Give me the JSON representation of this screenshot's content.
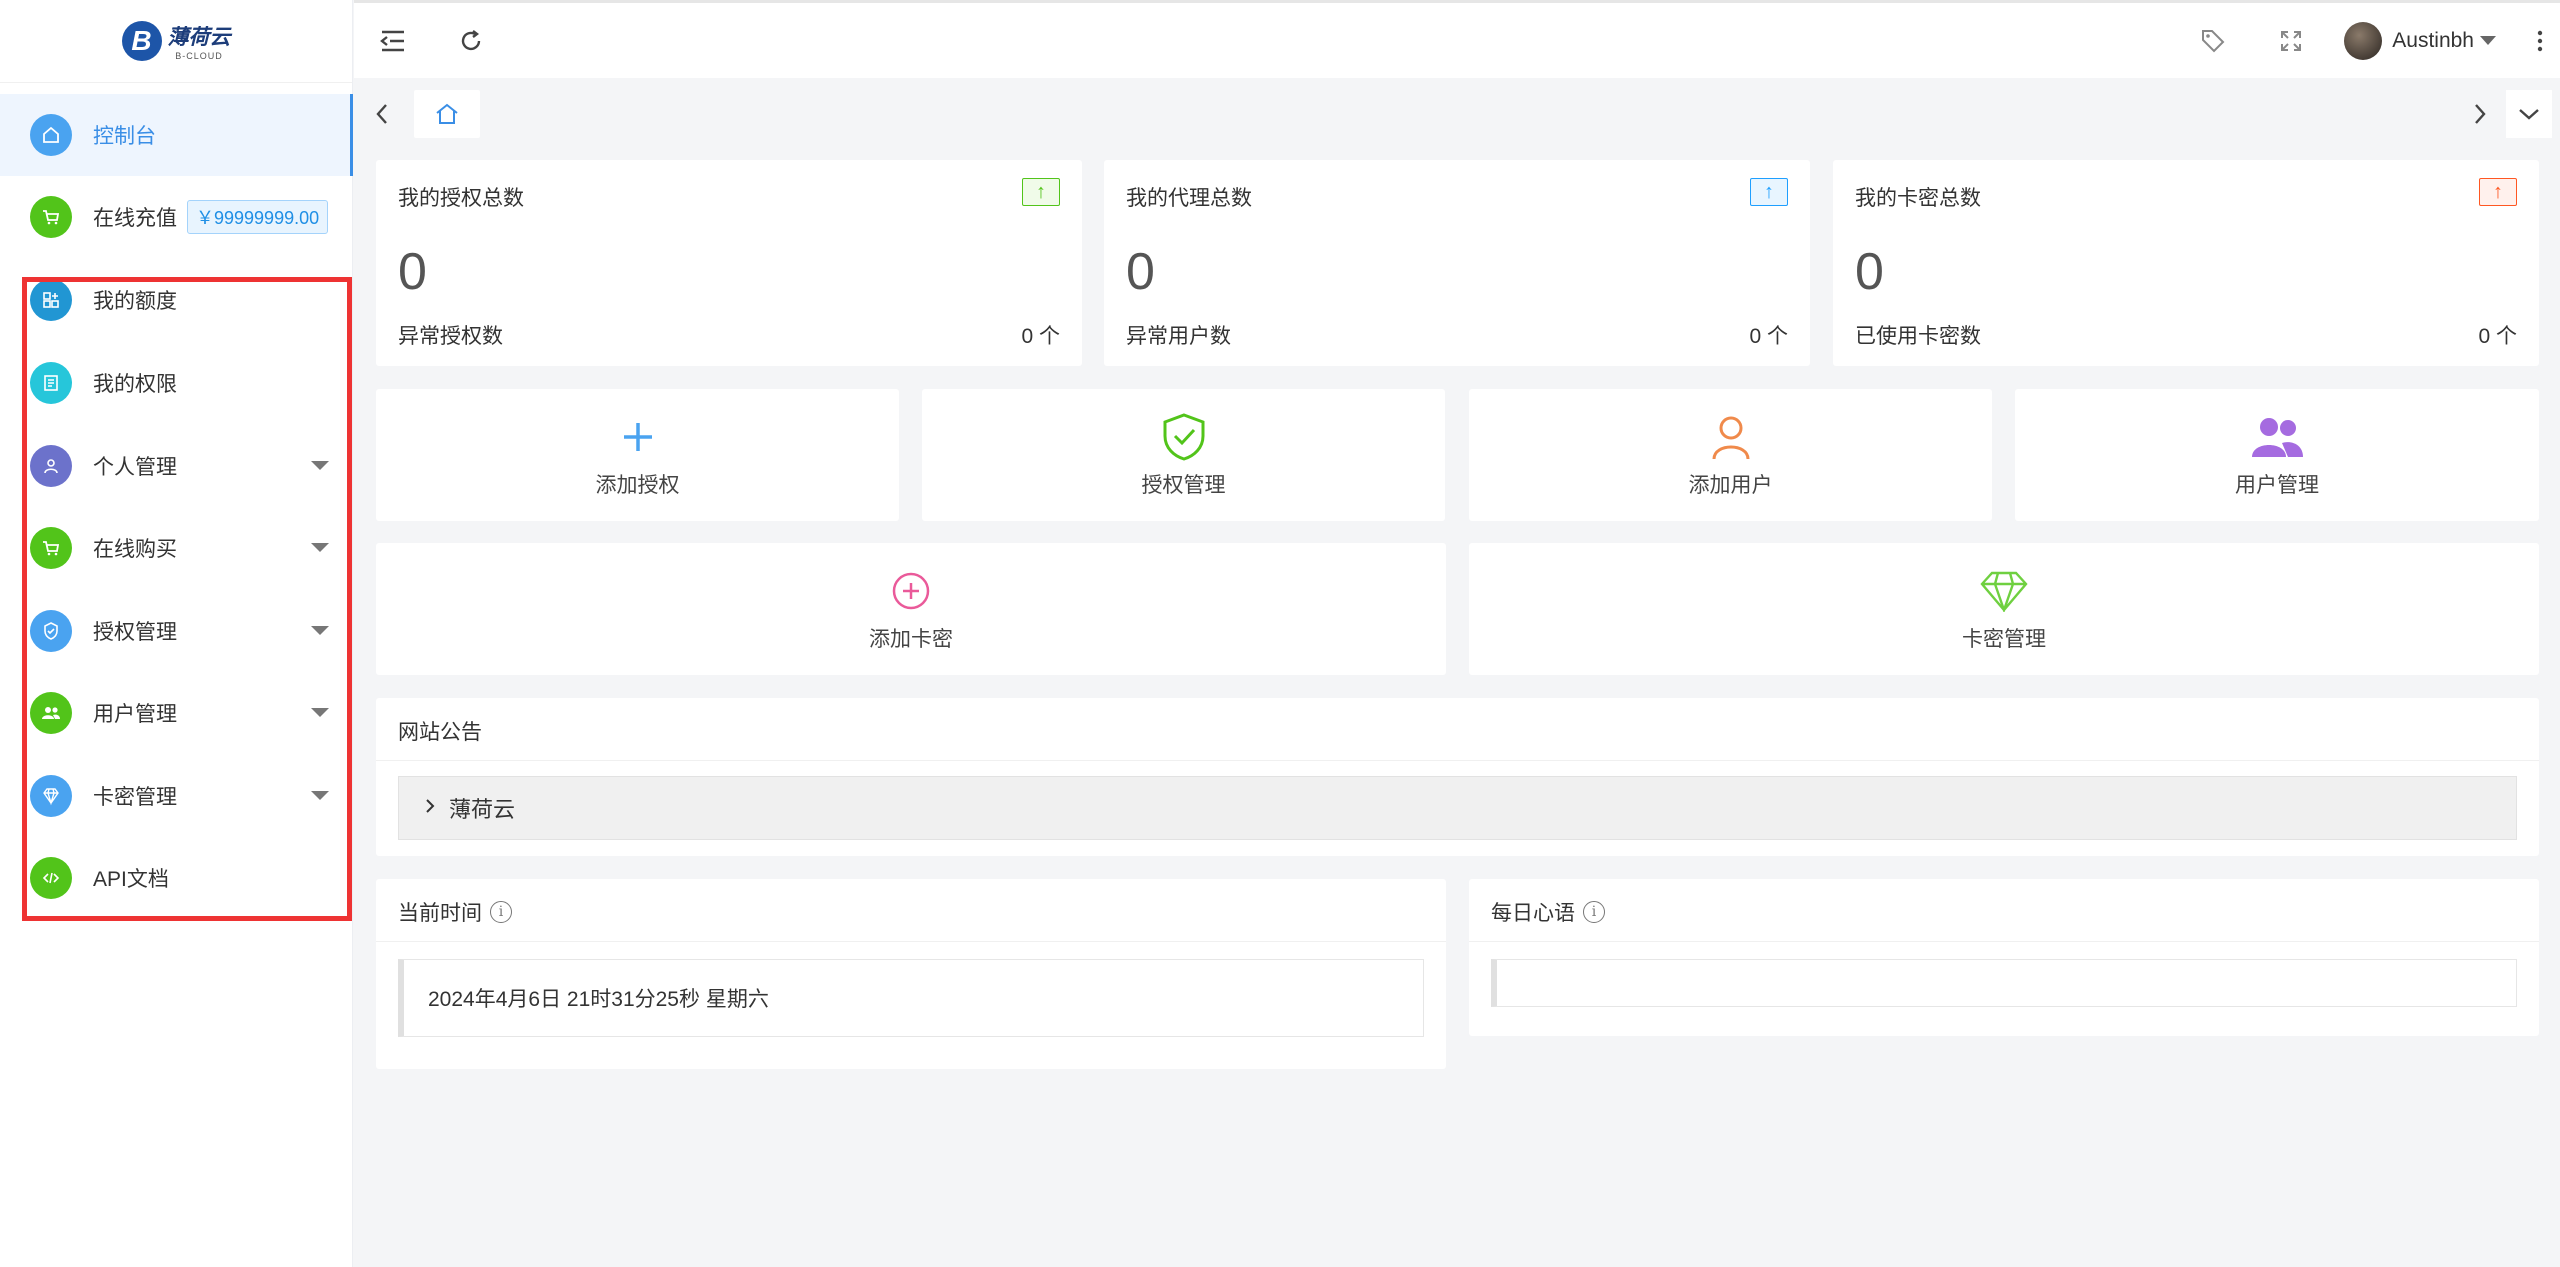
{
  "logo": {
    "mark": "B",
    "title": "薄荷云",
    "subtitle": "B-CLOUD"
  },
  "sidebar": {
    "items": [
      {
        "label": "控制台",
        "icon": "home-icon",
        "color": "#4aa3f0"
      },
      {
        "label": "在线充值",
        "icon": "cart-icon",
        "color": "#52c41a",
        "badge": "￥99999999.00"
      },
      {
        "label": "我的额度",
        "icon": "quota-icon",
        "color": "#2196d3"
      },
      {
        "label": "我的权限",
        "icon": "permission-icon",
        "color": "#26c6da"
      },
      {
        "label": "个人管理",
        "icon": "user-icon",
        "color": "#6c72cb"
      },
      {
        "label": "在线购买",
        "icon": "cart-icon",
        "color": "#52c41a"
      },
      {
        "label": "授权管理",
        "icon": "shield-icon",
        "color": "#4aa3f0"
      },
      {
        "label": "用户管理",
        "icon": "users-icon",
        "color": "#52c41a"
      },
      {
        "label": "卡密管理",
        "icon": "diamond-icon",
        "color": "#4aa3f0"
      },
      {
        "label": "API文档",
        "icon": "code-icon",
        "color": "#52c41a"
      }
    ]
  },
  "header": {
    "username": "Austinbh"
  },
  "stats": [
    {
      "title": "我的授权总数",
      "value": "0",
      "sub": "异常授权数",
      "count": "0 个",
      "badge_color": "#52c41a"
    },
    {
      "title": "我的代理总数",
      "value": "0",
      "sub": "异常用户数",
      "count": "0 个",
      "badge_color": "#1e9fff"
    },
    {
      "title": "我的卡密总数",
      "value": "0",
      "sub": "已使用卡密数",
      "count": "0 个",
      "badge_color": "#ff5722"
    }
  ],
  "quick_actions": [
    {
      "label": "添加授权",
      "icon": "plus-icon"
    },
    {
      "label": "授权管理",
      "icon": "shield-check-icon"
    },
    {
      "label": "添加用户",
      "icon": "user-outline-icon"
    },
    {
      "label": "用户管理",
      "icon": "users-icon"
    },
    {
      "label": "添加卡密",
      "icon": "circle-plus-icon"
    },
    {
      "label": "卡密管理",
      "icon": "diamond-icon"
    }
  ],
  "notice": {
    "title": "网站公告",
    "item": "薄荷云"
  },
  "time_panel": {
    "title": "当前时间",
    "value": "2024年4月6日 21时31分25秒 星期六"
  },
  "quote_panel": {
    "title": "每日心语",
    "value": ""
  }
}
